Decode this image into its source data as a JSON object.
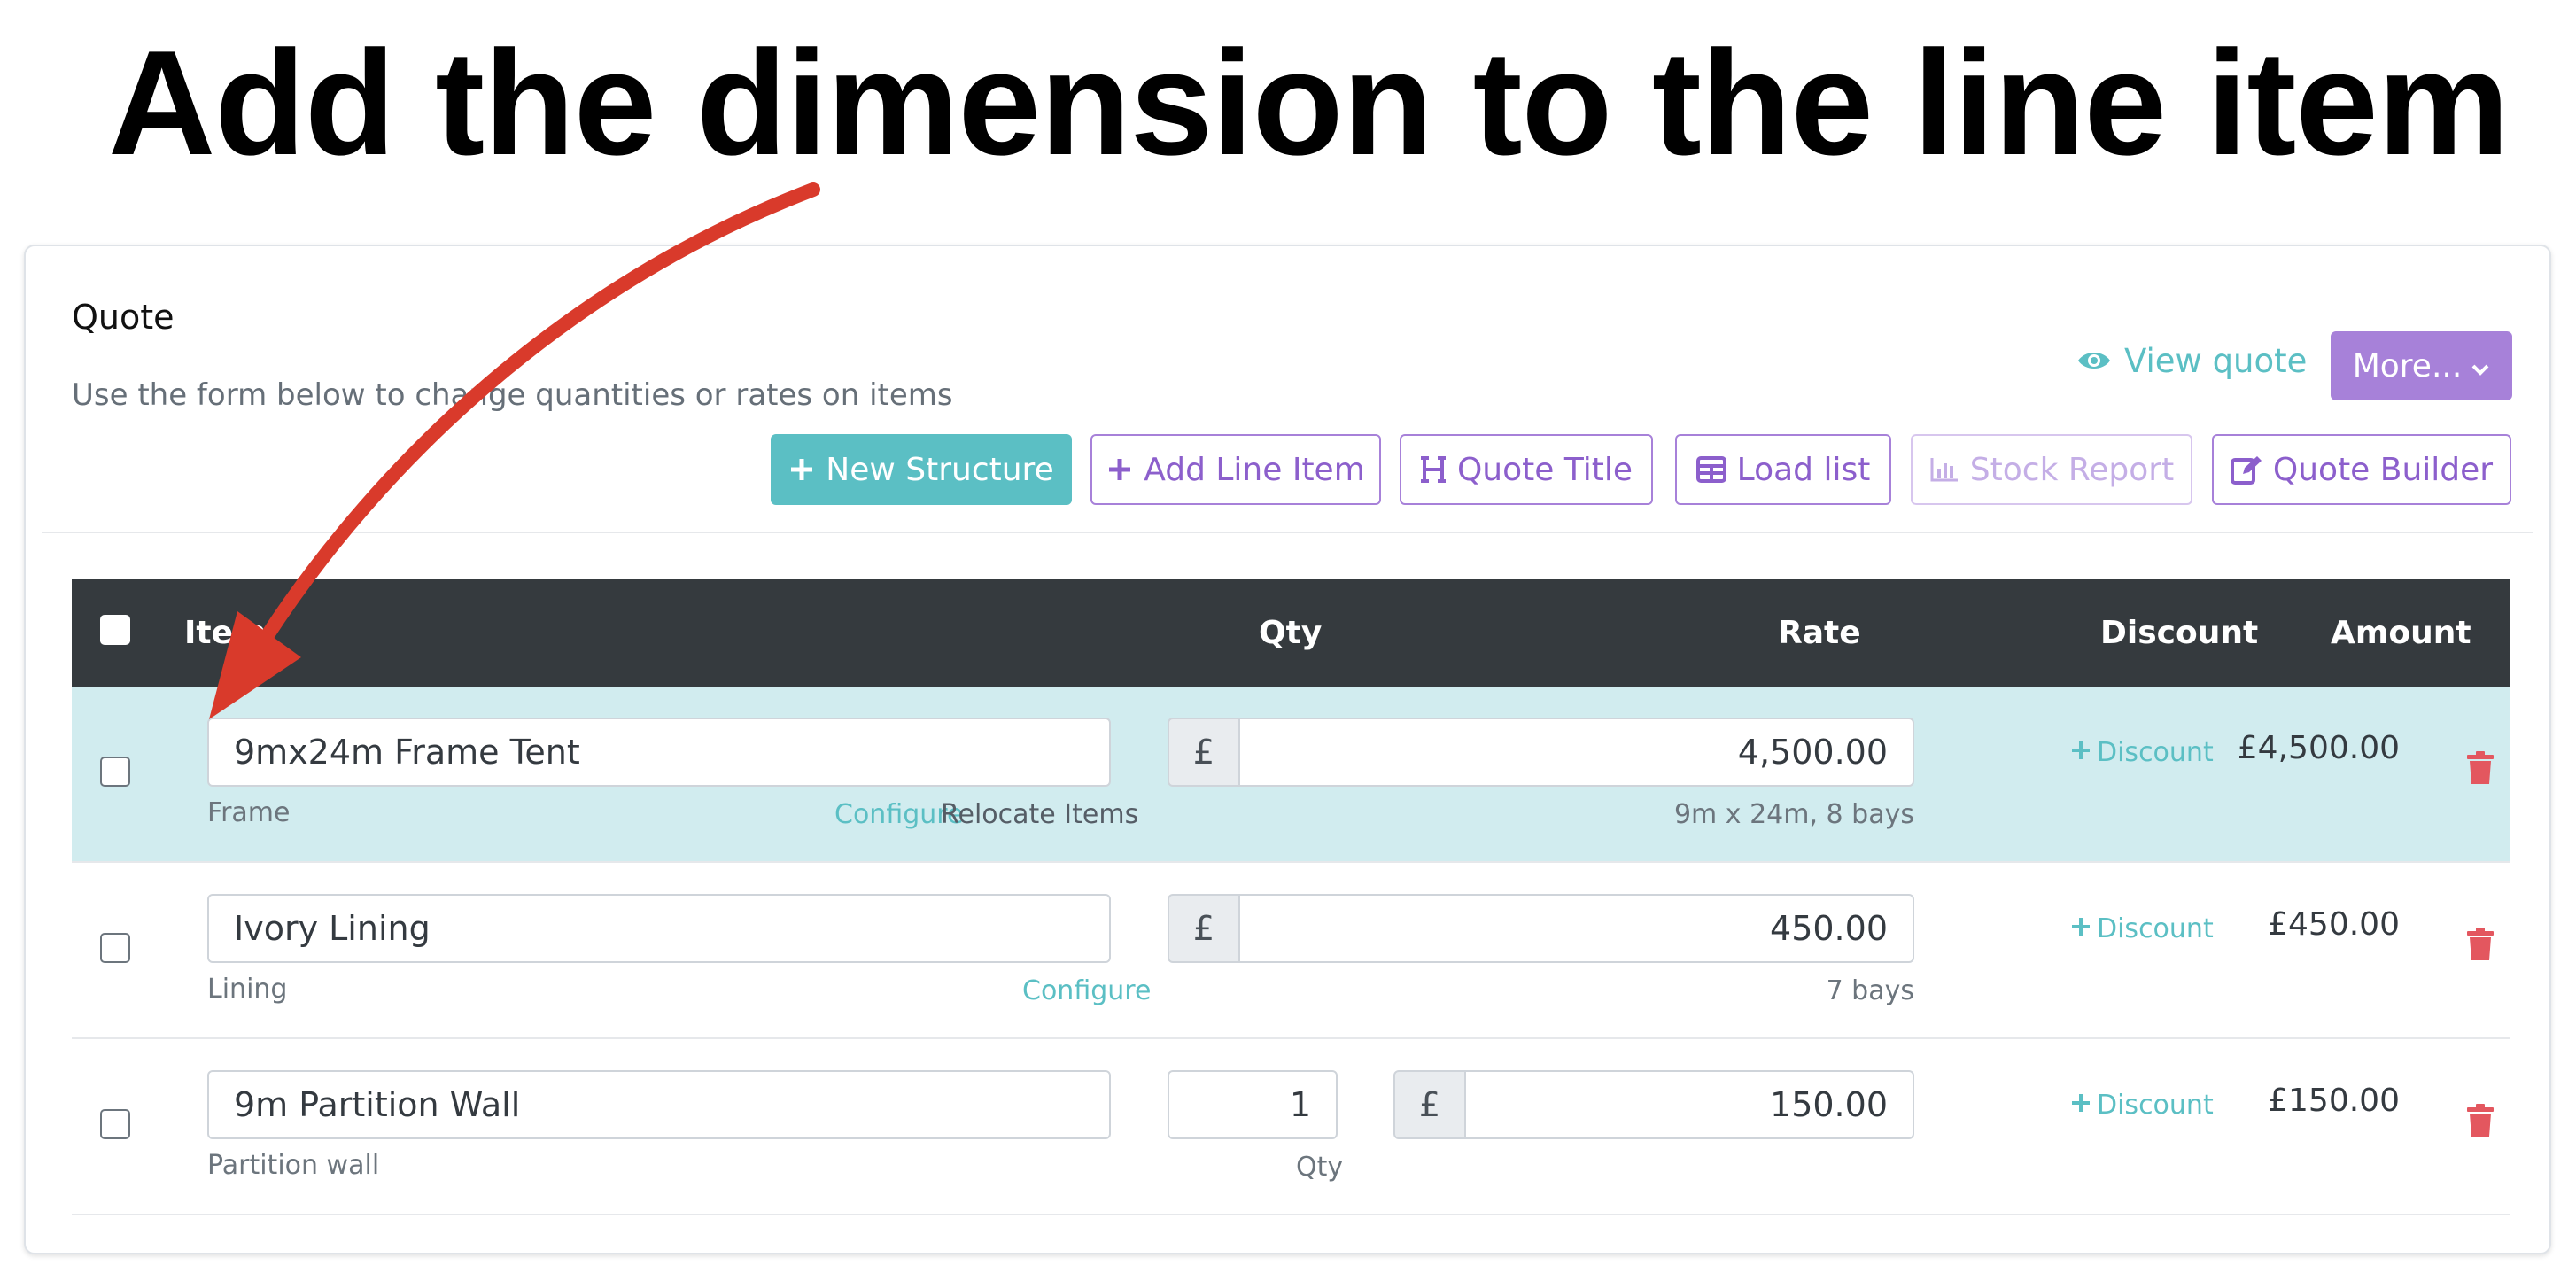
{
  "headline": "Add the dimension to the line item",
  "quote": {
    "title": "Quote",
    "subtitle": "Use the form below to change quantities or rates on items",
    "view_quote": "View quote",
    "more": "More...",
    "buttons": {
      "new_structure": "New Structure",
      "add_line_item": "Add Line Item",
      "quote_title": "Quote Title",
      "load_list": "Load list",
      "stock_report": "Stock Report",
      "quote_builder": "Quote Builder"
    },
    "table": {
      "headers": {
        "item": "Item",
        "qty": "Qty",
        "rate": "Rate",
        "discount": "Discount",
        "amount": "Amount"
      },
      "rows": [
        {
          "name": "9mx24m Frame Tent",
          "type": "Frame",
          "configure": "Configure",
          "relocate": "Relocate Items",
          "currency": "£",
          "rate": "4,500.00",
          "rate_note": "9m x 24m, 8 bays",
          "discount": "Discount",
          "amount": "£4,500.00"
        },
        {
          "name": "Ivory Lining",
          "type": "Lining",
          "configure": "Configure",
          "currency": "£",
          "rate": "450.00",
          "rate_note": "7 bays",
          "discount": "Discount",
          "amount": "£450.00"
        },
        {
          "name": "9m Partition Wall",
          "type": "Partition wall",
          "qty": "1",
          "qty_label": "Qty",
          "currency": "£",
          "rate": "150.00",
          "discount": "Discount",
          "amount": "£150.00"
        }
      ]
    }
  },
  "colors": {
    "teal": "#5bbfc4",
    "purple": "#a781d9",
    "header_dark": "#353a3e",
    "highlight_row": "#d1ecef",
    "trash_red": "#e3575f",
    "arrow_red": "#d93a2b"
  },
  "icons": [
    "plus-icon",
    "eye-icon",
    "chevron-down-icon",
    "heading-icon",
    "table-icon",
    "bar-chart-icon",
    "edit-icon",
    "trash-icon",
    "annotation-arrow"
  ]
}
